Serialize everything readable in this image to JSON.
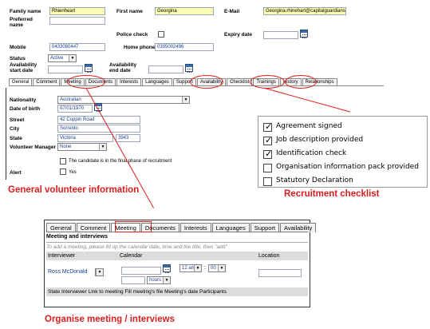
{
  "form": {
    "family_name_label": "Family name",
    "family_name_value": "Rhienheart",
    "first_name_label": "First name",
    "first_name_value": "Georgina",
    "email_label": "E-Mail",
    "email_value": "Georgina.rhinehart@capitalguardians",
    "preferred_name_label_1": "Preferred",
    "preferred_name_label_2": "name",
    "police_check_label": "Police check",
    "expiry_date_label": "Expiry date",
    "mobile_label": "Mobile",
    "mobile_value": "0433080447",
    "home_phone_label": "Home phone",
    "home_phone_value": "0395002496",
    "status_label": "Status",
    "status_value": "Active",
    "avail_start_label_1": "Availability",
    "avail_start_label_2": "start date",
    "avail_end_label_1": "Availability",
    "avail_end_label_2": "end date"
  },
  "tabs": [
    "General",
    "Comment",
    "Meeting",
    "Documents",
    "Interests",
    "Languages",
    "Support",
    "Availability",
    "Checklist",
    "Trainings",
    "History",
    "Relationships"
  ],
  "general": {
    "nationality_label": "Nationality",
    "nationality_value": "Australian",
    "dob_label": "Date of birth",
    "dob_value": "07/01/1970",
    "street_label": "Street",
    "street_value": "42 Coppin Road",
    "city_label": "City",
    "city_value": "Sorrento",
    "state_label": "State",
    "state_value": "Victoria",
    "postcode_value": "3943",
    "manager_label": "Volunteer Manager",
    "manager_value": "None",
    "final_phase_text": "The candidate is in the final phase of recruitment",
    "alert_label": "Alert",
    "alert_yes": "Yes"
  },
  "captions": {
    "general": "General volunteer information",
    "checklist": "Recruitment checklist",
    "meeting": "Organise meeting / interviews"
  },
  "checklist": [
    {
      "label": "Agreement signed",
      "checked": true
    },
    {
      "label": "Job description provided",
      "checked": true
    },
    {
      "label": "Identification check",
      "checked": true
    },
    {
      "label": "Organisation information pack provided",
      "checked": false
    },
    {
      "label": "Statutory Declaration",
      "checked": false
    }
  ],
  "meeting": {
    "tabs": [
      "General",
      "Comment",
      "Meeting",
      "Documents",
      "Interests",
      "Languages",
      "Support",
      "Availability"
    ],
    "title": "Meeting and interviews",
    "hint": "To add a meeting, please fill up the calendar date, time and the title, then \"add\"",
    "col_interviewer": "Interviewer",
    "col_calendar": "Calendar",
    "col_location": "Location",
    "interviewer_value": "Ross McDonald",
    "hour_value": "12 am",
    "colon": ":",
    "minute_value": "00",
    "duration_unit": "hours",
    "footer": "State Interviewer Link to meeting Fill meeting's file Meeting's date Participants"
  },
  "colors": {
    "accent_red": "#e02020",
    "caption_red": "#d81e1e",
    "field_yellow": "#fcfcb4",
    "value_blue": "#1a3a8a"
  },
  "icons": [
    "calendar-icon",
    "dropdown-arrow-icon",
    "checkbox-icon",
    "checkmark-icon"
  ]
}
